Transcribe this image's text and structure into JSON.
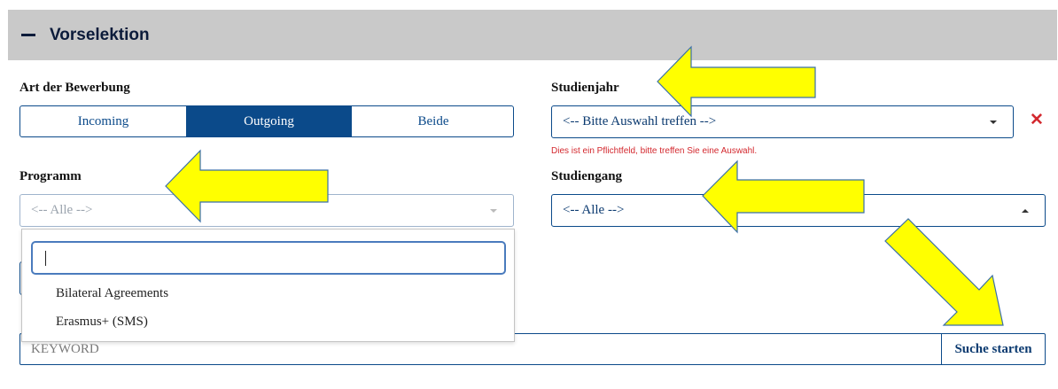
{
  "header": {
    "title": "Vorselektion",
    "collapse_icon": "minus-icon"
  },
  "art_der_bewerbung": {
    "label": "Art der Bewerbung",
    "options": [
      "Incoming",
      "Outgoing",
      "Beide"
    ],
    "selected": "Outgoing"
  },
  "studienjahr": {
    "label": "Studienjahr",
    "value": "<-- Bitte Auswahl treffen -->",
    "error": "Dies ist ein Pflichtfeld, bitte treffen Sie eine Auswahl."
  },
  "programm": {
    "label": "Programm",
    "value": "<-- Alle -->",
    "dropdown": {
      "search_value": "",
      "options": [
        "Bilateral Agreements",
        "Erasmus+ (SMS)"
      ]
    }
  },
  "studiengang": {
    "label": "Studiengang",
    "value": "<-- Alle -->"
  },
  "search": {
    "placeholder": "KEYWORD",
    "button_label": "Suche starten"
  },
  "annotation_color": "#ffff00"
}
